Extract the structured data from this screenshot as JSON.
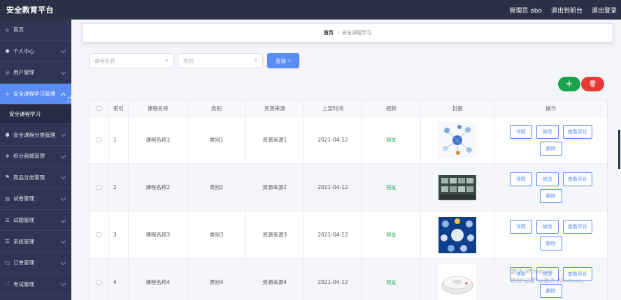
{
  "app": {
    "title": "安全教育平台",
    "user_label": "管理员 abo",
    "to_front": "退出到前台",
    "logout": "退出登录"
  },
  "sidebar": {
    "items": [
      {
        "label": "首页",
        "icon": "home-icon",
        "arrow": false
      },
      {
        "label": "个人中心",
        "icon": "user-icon",
        "arrow": true
      },
      {
        "label": "用户管理",
        "icon": "users-icon",
        "arrow": true
      },
      {
        "label": "安全课程学习管理",
        "icon": "gear-icon",
        "arrow": true,
        "active": true
      },
      {
        "label": "安全课程分类管理",
        "icon": "user-icon",
        "arrow": true
      },
      {
        "label": "积分商城管理",
        "icon": "gear-icon",
        "arrow": true
      },
      {
        "label": "商品分类管理",
        "icon": "flag-icon",
        "arrow": true
      },
      {
        "label": "试卷管理",
        "icon": "doc-icon",
        "arrow": true
      },
      {
        "label": "试题管理",
        "icon": "list-icon",
        "arrow": true
      },
      {
        "label": "系统管理",
        "icon": "list-icon",
        "arrow": true
      },
      {
        "label": "订单管理",
        "icon": "square-icon",
        "arrow": true
      },
      {
        "label": "考试管理",
        "icon": "frame-icon",
        "arrow": true
      }
    ],
    "submenu_label": "安全课程学习"
  },
  "breadcrumb": {
    "home": "首页",
    "current": "安全课程学习"
  },
  "search": {
    "name_placeholder": "课程名称",
    "type_placeholder": "类别",
    "query_label": "查询"
  },
  "table": {
    "headers": [
      "",
      "索引",
      "课程名称",
      "类别",
      "资源来源",
      "上架时间",
      "视频",
      "封面",
      "操作"
    ],
    "rows": [
      {
        "index": "1",
        "name": "课程名称1",
        "type": "类别1",
        "source": "资源来源1",
        "date": "2021-04-12",
        "video": "预览",
        "cover": "diagram"
      },
      {
        "index": "2",
        "name": "课程名称2",
        "type": "类别2",
        "source": "资源来源2",
        "date": "2021-04-12",
        "video": "预览",
        "cover": "monitors"
      },
      {
        "index": "3",
        "name": "课程名称3",
        "type": "类别3",
        "source": "资源来源3",
        "date": "2021-04-12",
        "video": "预览",
        "cover": "network"
      },
      {
        "index": "4",
        "name": "课程名称4",
        "type": "类别4",
        "source": "资源来源4",
        "date": "2021-04-12",
        "video": "预览",
        "cover": "detector"
      }
    ],
    "ops": {
      "detail": "详情",
      "edit": "修改",
      "comments": "查看评论",
      "delete": "删除"
    }
  },
  "watermark": {
    "line1": "激活 Windows",
    "line2": "转到\"设置\"以激活 Windows。"
  },
  "colors": {
    "accent": "#5b8cf5",
    "topbar": "#2a3046",
    "sidebar": "#2f3653",
    "add": "#1aa34a",
    "delete": "#e23b33"
  }
}
